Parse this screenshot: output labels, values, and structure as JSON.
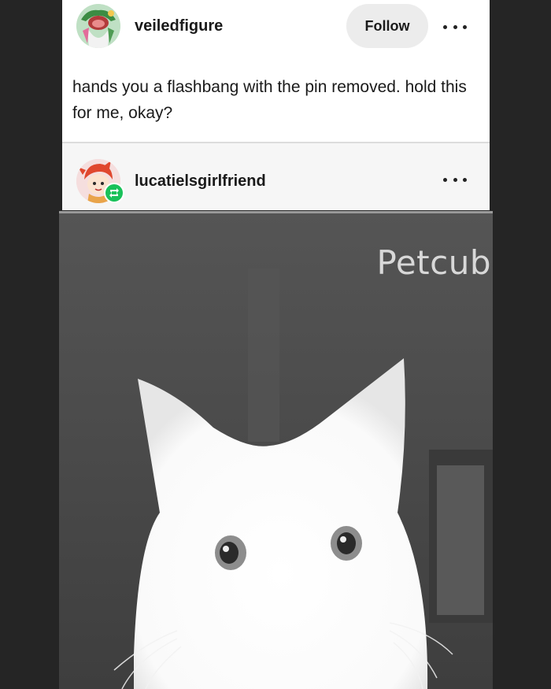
{
  "post": {
    "author": "veiledfigure",
    "follow_label": "Follow",
    "text": "hands you a flashbang with the pin removed. hold this for me, okay?"
  },
  "reblog": {
    "author": "lucatielsgirlfriend"
  },
  "photo": {
    "watermark": "Petcub"
  },
  "icons": {
    "more": "more-options-icon",
    "reblog": "reblog-icon"
  },
  "colors": {
    "background": "#252525",
    "card": "#ffffff",
    "follow_button": "#ececec",
    "reblog_badge": "#19c15a"
  }
}
